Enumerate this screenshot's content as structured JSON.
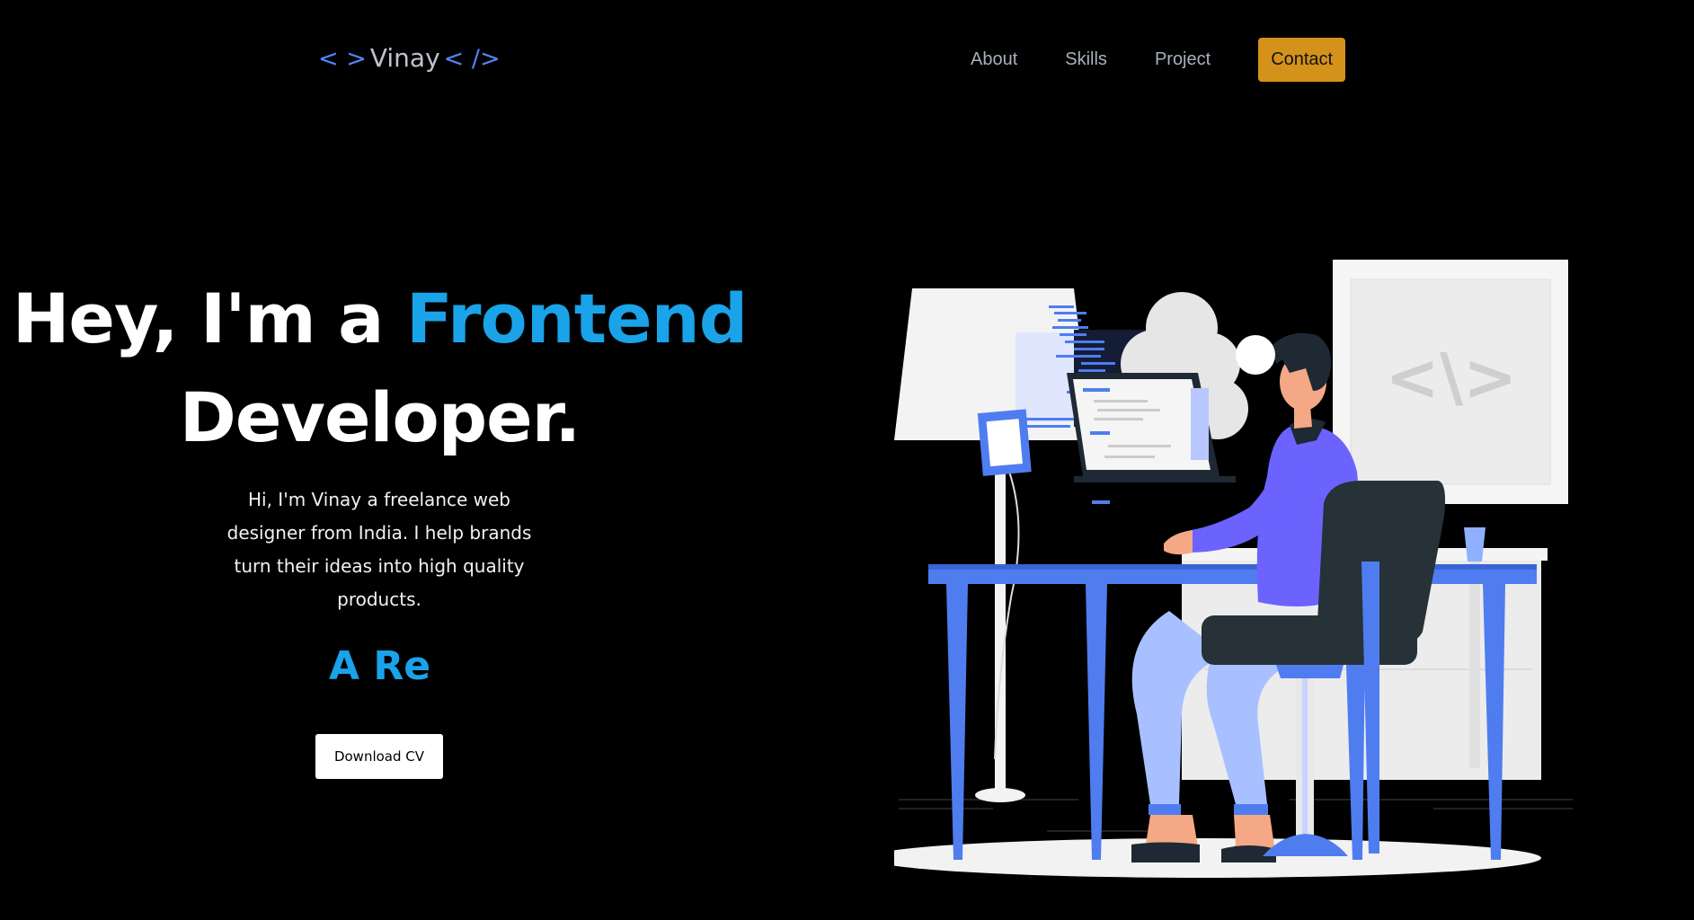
{
  "nav": {
    "logo_open": "< >",
    "logo_name": "Vinay",
    "logo_close": "< />",
    "items": [
      {
        "label": "About"
      },
      {
        "label": "Skills"
      },
      {
        "label": "Project"
      }
    ],
    "contact_label": "Contact"
  },
  "hero": {
    "title_part1": "Hey, I'm a",
    "title_accent": "Frontend",
    "title_part2": "Developer.",
    "intro": "Hi, I'm Vinay a freelance web designer from India. I help brands turn their ideas into high quality products.",
    "typing_text": "A Re",
    "cv_button": "Download CV"
  },
  "illustration": {
    "monitor_code": "<\\>"
  },
  "colors": {
    "accent": "#1aa3e8",
    "contact_bg": "#d4921a",
    "desk": "#4f7df0",
    "shirt": "#6c63ff",
    "background": "#000000"
  }
}
